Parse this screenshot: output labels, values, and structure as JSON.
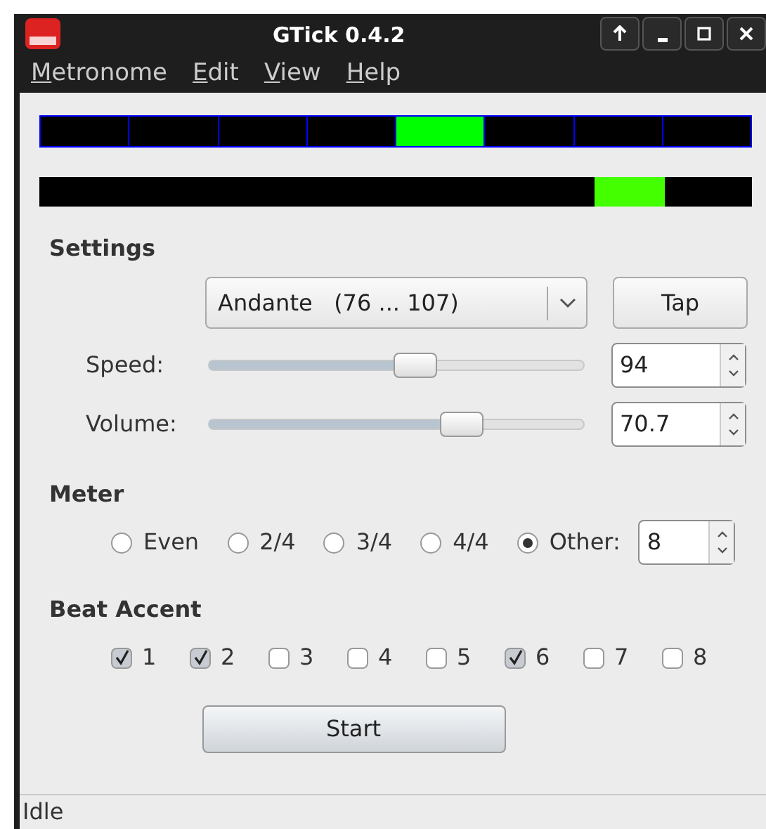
{
  "window": {
    "title": "GTick 0.4.2"
  },
  "menu": [
    "Metronome",
    "Edit",
    "View",
    "Help"
  ],
  "beats": [
    {
      "active": false
    },
    {
      "active": false
    },
    {
      "active": false
    },
    {
      "active": false
    },
    {
      "active": true
    },
    {
      "active": false
    },
    {
      "active": false
    },
    {
      "active": false
    }
  ],
  "pendulum": {
    "level": 0.78
  },
  "settings": {
    "heading": "Settings",
    "tempo": "Andante   (76 ... 107)",
    "tap": "Tap",
    "sliders": [
      {
        "label": "Speed:",
        "level": 0.55,
        "value": "94"
      },
      {
        "label": "Volume:",
        "level": 0.67,
        "value": "70.7"
      }
    ]
  },
  "meter": {
    "heading": "Meter",
    "options": [
      {
        "label": "Even",
        "selected": false
      },
      {
        "label": "2/4",
        "selected": false
      },
      {
        "label": "3/4",
        "selected": false
      },
      {
        "label": "4/4",
        "selected": false
      },
      {
        "label": "Other:",
        "selected": true
      }
    ],
    "other_value": "8"
  },
  "accent": {
    "heading": "Beat Accent",
    "beats": [
      {
        "label": "1",
        "checked": true
      },
      {
        "label": "2",
        "checked": true
      },
      {
        "label": "3",
        "checked": false
      },
      {
        "label": "4",
        "checked": false
      },
      {
        "label": "5",
        "checked": false
      },
      {
        "label": "6",
        "checked": true
      },
      {
        "label": "7",
        "checked": false
      },
      {
        "label": "8",
        "checked": false
      }
    ]
  },
  "start": "Start",
  "status_bar": "Idle"
}
